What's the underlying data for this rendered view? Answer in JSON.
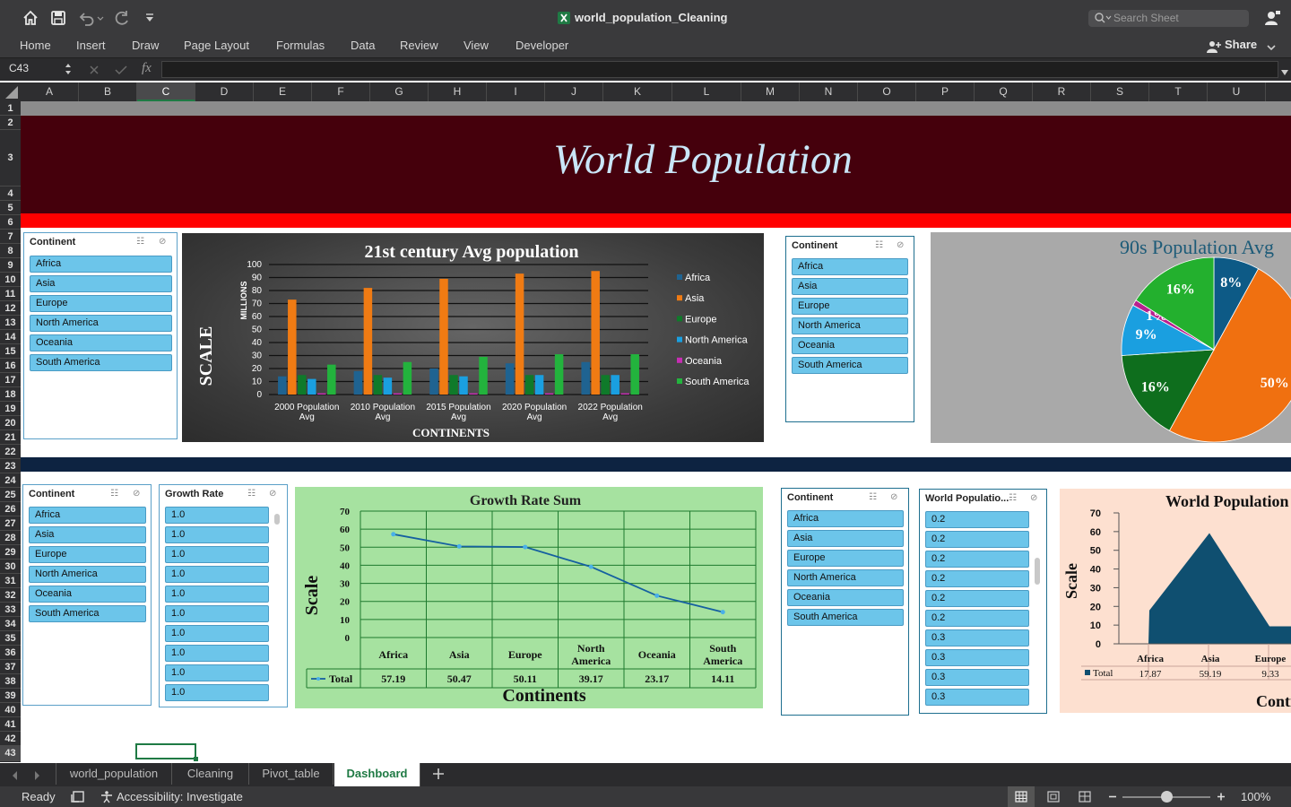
{
  "app": {
    "title": "world_population_Cleaning",
    "search_placeholder": "Search Sheet",
    "share_label": "Share"
  },
  "ribbon_tabs": [
    "Home",
    "Insert",
    "Draw",
    "Page Layout",
    "Formulas",
    "Data",
    "Review",
    "View",
    "Developer"
  ],
  "formula_bar": {
    "name_box": "C43",
    "fx": "fx",
    "value": ""
  },
  "columns": [
    "A",
    "B",
    "C",
    "D",
    "E",
    "F",
    "G",
    "H",
    "I",
    "J",
    "K",
    "L",
    "M",
    "N",
    "O",
    "P",
    "Q",
    "R",
    "S",
    "T",
    "U"
  ],
  "rows": [
    "1",
    "2",
    "3",
    "4",
    "5",
    "6",
    "7",
    "8",
    "9",
    "10",
    "11",
    "12",
    "13",
    "14",
    "15",
    "16",
    "17",
    "18",
    "19",
    "20",
    "21",
    "22",
    "23",
    "24",
    "25",
    "26",
    "27",
    "28",
    "29",
    "30",
    "31",
    "32",
    "33",
    "34",
    "35",
    "36",
    "37",
    "38",
    "39",
    "40",
    "41",
    "42",
    "43"
  ],
  "banner": {
    "title": "World Population"
  },
  "continents": [
    "Africa",
    "Asia",
    "Europe",
    "North America",
    "Oceania",
    "South America"
  ],
  "slicers": {
    "continent": "Continent",
    "growth_rate": "Growth Rate",
    "world_pop": "World Populatio...",
    "growth_values": [
      "1.0",
      "1.0",
      "1.0",
      "1.0",
      "1.0",
      "1.0",
      "1.0",
      "1.0",
      "1.0",
      "1.0"
    ],
    "world_pop_values": [
      "0.2",
      "0.2",
      "0.2",
      "0.2",
      "0.2",
      "0.2",
      "0.3",
      "0.3",
      "0.3",
      "0.3"
    ]
  },
  "chart_data": [
    {
      "type": "bar",
      "title": "21st century Avg population",
      "xlabel": "CONTINENTS",
      "ylabel": "SCALE",
      "ylabel2": "MILLIONS",
      "ylim": [
        0,
        100
      ],
      "yticks": [
        "0",
        "10",
        "20",
        "30",
        "40",
        "50",
        "60",
        "70",
        "80",
        "90",
        "100"
      ],
      "categories": [
        "2000 Population Avg",
        "2010 Population Avg",
        "2015 Population Avg",
        "2020 Population Avg",
        "2022 Population Avg"
      ],
      "series": [
        {
          "name": "Africa",
          "color": "#1f6391",
          "values": [
            14,
            18,
            20,
            24,
            25
          ]
        },
        {
          "name": "Asia",
          "color": "#f07b13",
          "values": [
            73,
            82,
            89,
            93,
            95
          ]
        },
        {
          "name": "Europe",
          "color": "#0f7a2a",
          "values": [
            15,
            15,
            15,
            15,
            15
          ]
        },
        {
          "name": "North America",
          "color": "#1a9fe0",
          "values": [
            12,
            13,
            14,
            15,
            15
          ]
        },
        {
          "name": "Oceania",
          "color": "#c62db3",
          "values": [
            1,
            1,
            1,
            1,
            1
          ]
        },
        {
          "name": "South America",
          "color": "#23b33d",
          "values": [
            23,
            25,
            29,
            31,
            31
          ]
        }
      ],
      "legend": "right",
      "grid": true
    },
    {
      "type": "pie",
      "title": "90s Population Avg",
      "labels": [
        "8%",
        "50%",
        "16%",
        "9%",
        "1%",
        "16%"
      ],
      "values": [
        8,
        50,
        16,
        9,
        1,
        16
      ],
      "colors": [
        "#0d5a86",
        "#f07010",
        "#0e6e1d",
        "#1a9fe0",
        "#b8208f",
        "#23b02e"
      ]
    },
    {
      "type": "line",
      "title": "Growth Rate Sum",
      "xlabel": "Continents",
      "ylabel": "Scale",
      "ylim": [
        0,
        70
      ],
      "yticks": [
        "0",
        "10",
        "20",
        "30",
        "40",
        "50",
        "60",
        "70"
      ],
      "categories": [
        "Africa",
        "Asia",
        "Europe",
        "North America",
        "Oceania",
        "South America"
      ],
      "series": [
        {
          "name": "Total",
          "values": [
            57.19,
            50.47,
            50.11,
            39.17,
            23.17,
            14.11
          ]
        }
      ],
      "table_values": [
        "57.19",
        "50.47",
        "50.11",
        "39.17",
        "23.17",
        "14.11"
      ],
      "grid": true
    },
    {
      "type": "area",
      "title": "World Population",
      "xlabel": "Contin",
      "ylabel": "Scale",
      "ylim": [
        0,
        70
      ],
      "yticks": [
        "0",
        "10",
        "20",
        "30",
        "40",
        "50",
        "60",
        "70"
      ],
      "categories": [
        "Africa",
        "Asia",
        "Europe"
      ],
      "series": [
        {
          "name": "Total",
          "values": [
            17.87,
            59.19,
            9.33
          ]
        }
      ],
      "table_values": [
        "17.87",
        "59.19",
        "9.33"
      ]
    }
  ],
  "sheet_tabs": [
    "world_population",
    "Cleaning",
    "Pivot_table",
    "Dashboard"
  ],
  "status": {
    "ready": "Ready",
    "accessibility": "Accessibility: Investigate",
    "zoom": "100%"
  },
  "colors": {
    "banner": "#45000c",
    "red_bar": "#ff0000",
    "navy_bar": "#0d2341",
    "slicer_item": "#6cc5ea"
  }
}
